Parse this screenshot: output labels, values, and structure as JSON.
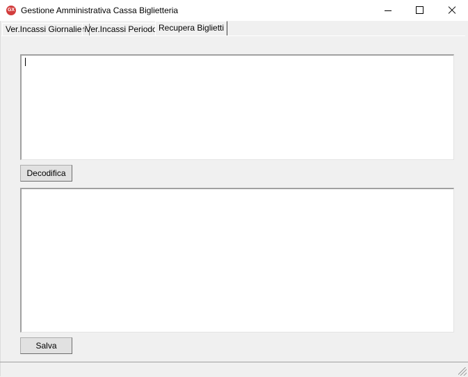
{
  "window": {
    "title": "Gestione Amministrativa Cassa Biglietteria",
    "icon_label": "GX"
  },
  "tabs": [
    {
      "label": "Ver.Incassi Giornalieri",
      "active": false
    },
    {
      "label": "Ver.Incassi Periodo",
      "active": false
    },
    {
      "label": "Recupera Biglietti",
      "active": true
    }
  ],
  "panel": {
    "input_text": "",
    "decode_button_label": "Decodifica",
    "output_text": "",
    "save_button_label": "Salva"
  },
  "colors": {
    "app_icon": "#d23c3c",
    "window_bg": "#f0f0f0",
    "button_bg": "#e1e1e1"
  }
}
